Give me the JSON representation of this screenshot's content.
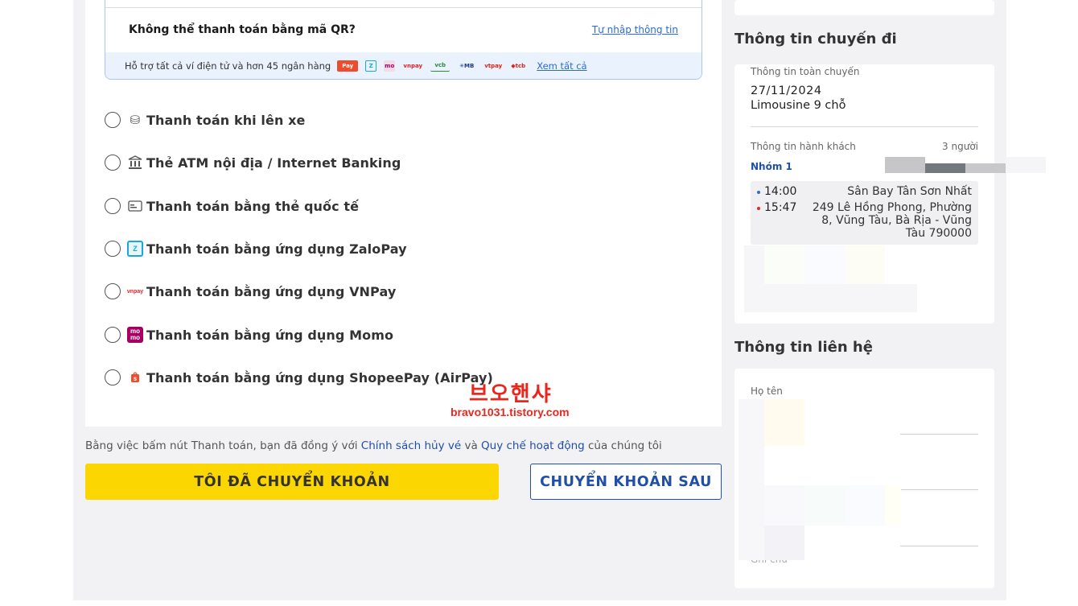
{
  "qr": {
    "question": "Không thể thanh toán bằng mã QR?",
    "manual_link": "Tự nhập thông tin",
    "support_text": "Hỗ trợ tất cả ví điện tử và hơn 45 ngân hàng",
    "see_all": "Xem tất cả",
    "bank_icons": [
      "shopeepay-icon",
      "zalopay-icon",
      "momo-icon",
      "vnpay-icon",
      "vietcombank-icon",
      "mb-icon",
      "viettelpay-icon",
      "techcombank-icon"
    ]
  },
  "payment_methods": [
    {
      "label": "Thanh toán khi lên xe",
      "icon": "cash-icon"
    },
    {
      "label": "Thẻ ATM nội địa / Internet Banking",
      "icon": "bank-icon"
    },
    {
      "label": "Thanh toán bằng thẻ quốc tế",
      "icon": "credit-card-icon"
    },
    {
      "label": "Thanh toán bằng ứng dụng ZaloPay",
      "icon": "zalopay-icon"
    },
    {
      "label": "Thanh toán bằng ứng dụng VNPay",
      "icon": "vnpay-icon"
    },
    {
      "label": "Thanh toán bằng ứng dụng Momo",
      "icon": "momo-icon"
    },
    {
      "label": "Thanh toán bằng ứng dụng ShopeePay (AirPay)",
      "icon": "shopeepay-icon"
    }
  ],
  "watermark": {
    "title": "브오핸샤",
    "url": "bravo1031.tistory.com"
  },
  "terms": {
    "prefix": "Bằng việc bấm nút Thanh toán, bạn đã đồng ý với ",
    "policy_link": "Chính sách hủy vé",
    "and": " và ",
    "rules_link": "Quy chế hoạt động",
    "suffix": " của chúng tôi"
  },
  "buttons": {
    "transferred": "TÔI ĐÃ CHUYỂN KHOẢN",
    "transfer_later": "CHUYỂN KHOẢN SAU"
  },
  "trip": {
    "section_title": "Thông tin chuyến đi",
    "subtitle": "Thông tin toàn chuyến",
    "date": "27/11/2024",
    "vehicle": "Limousine 9 chỗ",
    "passengers_label": "Thông tin hành khách",
    "passengers_count": "3 người",
    "group": "Nhóm 1",
    "departure_time": "14:00",
    "departure_place": "Sân Bay Tân Sơn Nhất",
    "arrival_time": "15:47",
    "arrival_place": "249 Lê Hồng Phong, Phường 8, Vũng Tàu, Bà Rịa - Vũng Tàu 790000"
  },
  "contact": {
    "section_title": "Thông tin liên hệ",
    "name_label": "Họ tên",
    "note_label": "Ghi chú"
  },
  "colors": {
    "primary_yellow": "#fcd600",
    "brand_blue": "#1f4fa8",
    "link_blue": "#2a6bd2",
    "watermark_red": "#e8281f"
  }
}
